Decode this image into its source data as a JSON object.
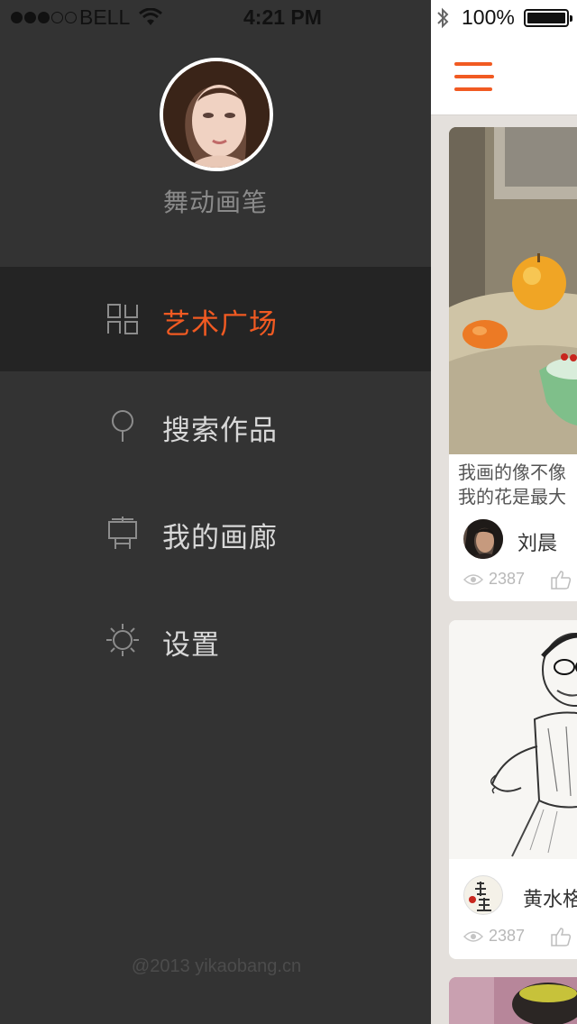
{
  "status_bar": {
    "carrier": "BELL",
    "time": "4:21 PM",
    "battery": "100%",
    "signal_bars_filled": 3,
    "signal_bars_total": 5
  },
  "side_menu": {
    "profile_name": "舞动画笔",
    "items": [
      {
        "label": "艺术广场",
        "icon": "grid-icon",
        "active": true
      },
      {
        "label": "搜索作品",
        "icon": "search-pin-icon",
        "active": false
      },
      {
        "label": "我的画廊",
        "icon": "easel-icon",
        "active": false
      },
      {
        "label": "设置",
        "icon": "gear-icon",
        "active": false
      }
    ],
    "copyright": "@2013 yikaobang.cn"
  },
  "feed": {
    "cards": [
      {
        "caption_line1": "我画的像不像",
        "caption_line2": "我的花是最大",
        "author": "刘晨",
        "views": "2387"
      },
      {
        "author": "黄水格",
        "views": "2387"
      }
    ]
  },
  "colors": {
    "accent": "#f15a22",
    "menu_bg": "#333333",
    "menu_active_bg": "#242424",
    "feed_bg": "#e4e0dc"
  }
}
